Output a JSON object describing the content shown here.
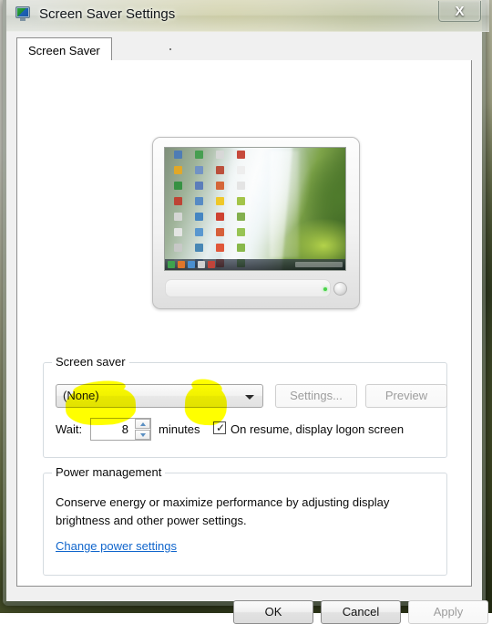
{
  "window": {
    "title": "Screen Saver Settings",
    "icon": "monitor-icon",
    "close_label": "X"
  },
  "tabs": [
    {
      "label": "Screen Saver",
      "selected": true
    }
  ],
  "preview": {
    "alt": "monitor-preview-waterfall-wallpaper",
    "desktop_icon_colors": [
      "#4a7ab8",
      "#3f9c4a",
      "#d8d8d8",
      "#c23b2b",
      "#e8a81f",
      "#6c8fc7",
      "#b8432e",
      "#ededed",
      "#2f8f3c",
      "#5577bb",
      "#d45b2a",
      "#e2e2e2",
      "#c0392b",
      "#4e86c4",
      "#f0c419",
      "#9bbf3a",
      "#d9d9d9",
      "#3a7fc1",
      "#cc3322",
      "#78a83f",
      "#e8e8e8",
      "#4f91cf",
      "#d5542b",
      "#8fbf45",
      "#c9c9c9",
      "#3c7fb1",
      "#e04a2a",
      "#7fb23c",
      "#dddddd",
      "#5a8ec8",
      "#cf3f27",
      "#6fae38"
    ],
    "taskbar_icon_colors": [
      "#3fa24e",
      "#e0762a",
      "#4a8fd0",
      "#d0d0d0",
      "#c0443a"
    ]
  },
  "screen_saver_group": {
    "title": "Screen saver",
    "combo": {
      "value": "(None)",
      "options": [
        "(None)"
      ],
      "arrow": "chevron-down-icon"
    },
    "settings_button": {
      "label": "Settings...",
      "disabled": true
    },
    "preview_button": {
      "label": "Preview",
      "disabled": true
    },
    "wait_label": "Wait:",
    "wait_value": "8",
    "minutes_label": "minutes",
    "logon_checkbox": {
      "label": "On resume, display logon screen",
      "checked": true,
      "glyph": "✓"
    }
  },
  "power_group": {
    "title": "Power management",
    "description": "Conserve energy or maximize performance by adjusting display brightness and other power settings.",
    "link": "Change power settings"
  },
  "footer": {
    "ok": {
      "label": "OK",
      "disabled": false
    },
    "cancel": {
      "label": "Cancel",
      "disabled": false
    },
    "apply": {
      "label": "Apply",
      "disabled": true
    }
  },
  "annotations": {
    "highlight_color": "#ffff00",
    "marks": [
      "wait-spinner-circled",
      "logon-checkbox-circled"
    ]
  }
}
